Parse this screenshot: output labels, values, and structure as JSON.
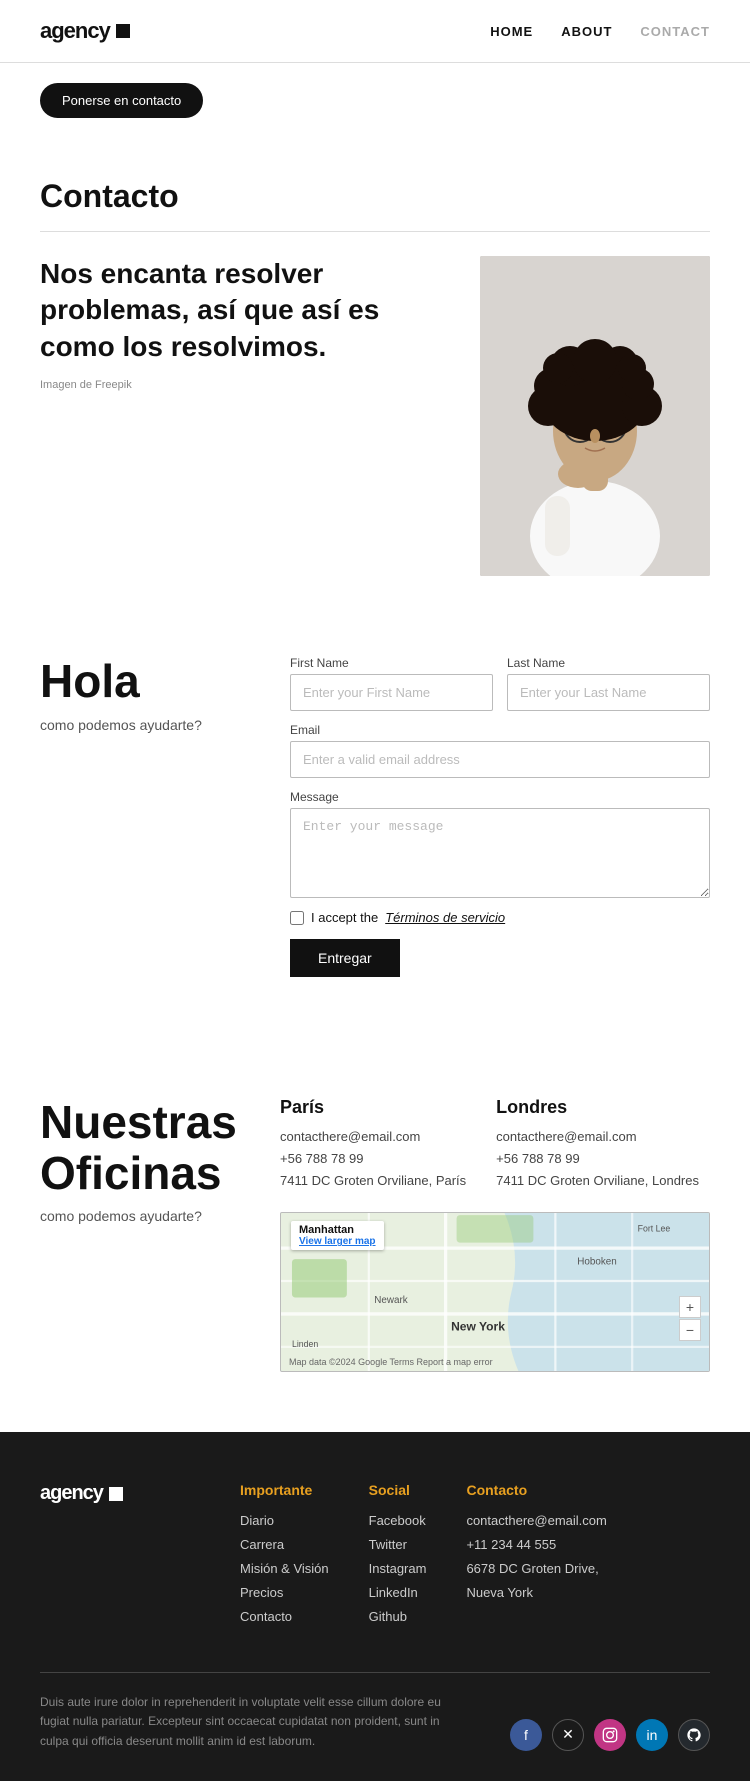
{
  "header": {
    "logo": "agency",
    "nav": [
      {
        "label": "HOME",
        "href": "#",
        "active": false
      },
      {
        "label": "ABOUT",
        "href": "#",
        "active": false
      },
      {
        "label": "CONTACT",
        "href": "#",
        "active": true
      }
    ]
  },
  "cta": {
    "button_label": "Ponerse en contacto"
  },
  "hero": {
    "title": "Contacto",
    "tagline": "Nos encanta resolver problemas, así que así es como los resolvimos.",
    "image_credit": "Imagen de Freepik"
  },
  "form_section": {
    "heading": "Hola",
    "subtext": "como podemos ayudarte?",
    "fields": {
      "first_name_label": "First Name",
      "first_name_placeholder": "Enter your First Name",
      "last_name_label": "Last Name",
      "last_name_placeholder": "Enter your Last Name",
      "email_label": "Email",
      "email_placeholder": "Enter a valid email address",
      "message_label": "Message",
      "message_placeholder": "Enter your message"
    },
    "checkbox_text": "I accept the ",
    "checkbox_link": "Términos de servicio",
    "submit_label": "Entregar"
  },
  "offices_section": {
    "heading": "Nuestras Oficinas",
    "subtext": "como podemos ayudarte?",
    "paris": {
      "city": "París",
      "email": "contacthere@email.com",
      "phone": "+56 788 78 99",
      "address": "7411 DC Groten Orviliane, París"
    },
    "london": {
      "city": "Londres",
      "email": "contacthere@email.com",
      "phone": "+56 788 78 99",
      "address": "7411 DC Groten Orviliane, Londres"
    },
    "map": {
      "label": "Manhattan",
      "link": "View larger map",
      "footer": "Map data ©2024 Google  Terms  Report a map error"
    }
  },
  "footer": {
    "logo": "agency",
    "columns": [
      {
        "heading": "Importante",
        "links": [
          "Diario",
          "Carrera",
          "Misión & Visión",
          "Precios",
          "Contacto"
        ]
      },
      {
        "heading": "Social",
        "links": [
          "Facebook",
          "Twitter",
          "Instagram",
          "LinkedIn",
          "Github"
        ]
      },
      {
        "heading": "Contacto",
        "links": [
          "contacthere@email.com",
          "+11 234 44 555",
          "6678 DC Groten Drive,",
          "Nueva York"
        ]
      }
    ],
    "body_text": "Duis aute irure dolor in reprehenderit in voluptate velit esse cillum dolore eu fugiat nulla pariatur. Excepteur sint occaecat cupidatat non proident, sunt in culpa qui officia deserunt mollit anim id est laborum.",
    "social": [
      {
        "name": "facebook",
        "symbol": "f"
      },
      {
        "name": "twitter",
        "symbol": "✕"
      },
      {
        "name": "instagram",
        "symbol": "📷"
      },
      {
        "name": "linkedin",
        "symbol": "in"
      },
      {
        "name": "github",
        "symbol": "🐙"
      }
    ]
  }
}
